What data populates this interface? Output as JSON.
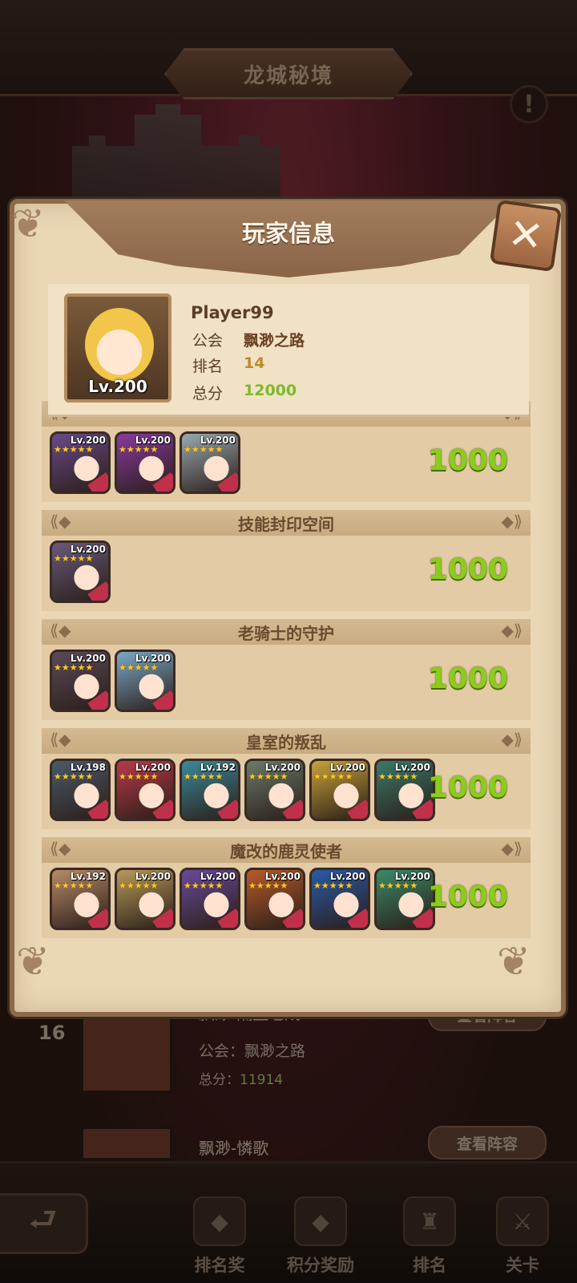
{
  "scene": {
    "title": "龙城秘境",
    "info_icon": "!"
  },
  "background_list": [
    {
      "rank": "16",
      "name": "飘渺-隔壁老成",
      "guild_label": "公会：",
      "guild": "飘渺之路",
      "score_label": "总分：",
      "score": "11914",
      "button": "查看阵容"
    },
    {
      "rank": "",
      "name": "飘渺-憐歌",
      "button": "查看阵容"
    }
  ],
  "nav": {
    "back_icon": "back-arrow-icon",
    "items": [
      {
        "label": "排名奖",
        "icon": "rank-reward-icon"
      },
      {
        "label": "积分奖励",
        "icon": "points-reward-icon"
      },
      {
        "label": "排名",
        "icon": "ranking-icon"
      },
      {
        "label": "关卡",
        "icon": "stage-icon"
      }
    ]
  },
  "popup": {
    "title": "玩家信息",
    "close_icon": "close-icon",
    "player": {
      "name": "Player99",
      "avatar_level": "Lv.200",
      "guild_label": "公会",
      "guild": "飘渺之路",
      "rank_label": "排名",
      "rank": "14",
      "score_label": "总分",
      "score": "12000"
    },
    "sections": [
      {
        "title": "",
        "score": "1000",
        "heroes": [
          {
            "lv": "Lv.200",
            "color": "#6a4a8a"
          },
          {
            "lv": "Lv.200",
            "color": "#8a3aa0"
          },
          {
            "lv": "Lv.200",
            "color": "#9aa8b0"
          }
        ]
      },
      {
        "title": "技能封印空间",
        "score": "1000",
        "heroes": [
          {
            "lv": "Lv.200",
            "color": "#6a5a7a"
          }
        ]
      },
      {
        "title": "老骑士的守护",
        "score": "1000",
        "heroes": [
          {
            "lv": "Lv.200",
            "color": "#5a4a58"
          },
          {
            "lv": "Lv.200",
            "color": "#7aa8c8"
          }
        ]
      },
      {
        "title": "皇室的叛乱",
        "score": "1000",
        "heroes": [
          {
            "lv": "Lv.198",
            "color": "#4a5a6a"
          },
          {
            "lv": "Lv.200",
            "color": "#b83a4a"
          },
          {
            "lv": "Lv.192",
            "color": "#3a8a9a"
          },
          {
            "lv": "Lv.200",
            "color": "#6a7a6a"
          },
          {
            "lv": "Lv.200",
            "color": "#c8a23a"
          },
          {
            "lv": "Lv.200",
            "color": "#3a7a6a"
          }
        ]
      },
      {
        "title": "魔改的鹿灵使者",
        "score": "1000",
        "heroes": [
          {
            "lv": "Lv.192",
            "color": "#b88a6a"
          },
          {
            "lv": "Lv.200",
            "color": "#b89a5a"
          },
          {
            "lv": "Lv.200",
            "color": "#6a4a9a"
          },
          {
            "lv": "Lv.200",
            "color": "#b85a2a"
          },
          {
            "lv": "Lv.200",
            "color": "#2a5aa8"
          },
          {
            "lv": "Lv.200",
            "color": "#3a8a6a"
          }
        ]
      }
    ]
  }
}
